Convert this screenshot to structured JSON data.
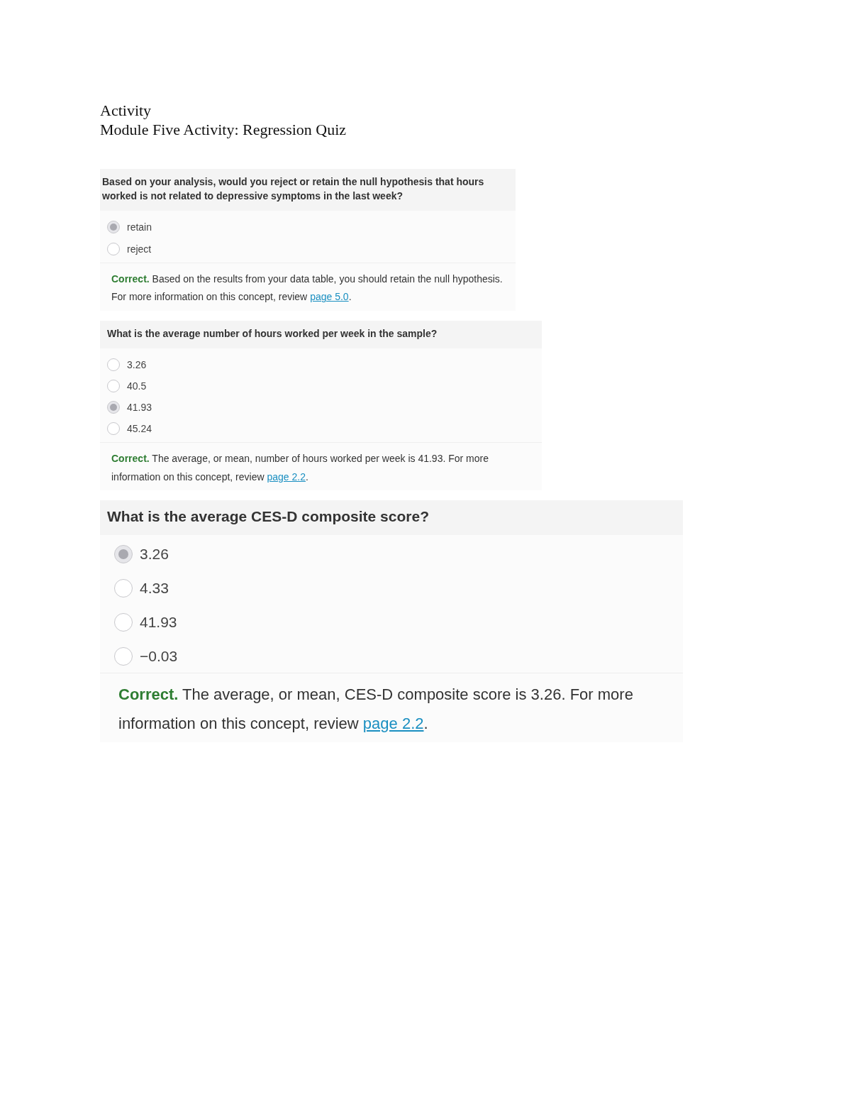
{
  "heading": {
    "lines": [
      "Activity",
      "Module Five Activity: Regression Quiz"
    ]
  },
  "questions": [
    {
      "prompt": "Based on your analysis, would you reject or retain the null hypothesis that hours worked is not related to depressive symptoms in the last week?",
      "options": [
        {
          "label": "retain",
          "selected": true
        },
        {
          "label": "reject",
          "selected": false
        }
      ],
      "feedback": {
        "verdict": "Correct.",
        "text": " Based on the results from your data table, you should retain the null hypothesis. For more information on this concept, review ",
        "link": "page 5.0",
        "after": "."
      }
    },
    {
      "prompt": "What is the average number of hours worked per week in the sample?",
      "options": [
        {
          "label": "3.26",
          "selected": false
        },
        {
          "label": "40.5",
          "selected": false
        },
        {
          "label": "41.93",
          "selected": true
        },
        {
          "label": "45.24",
          "selected": false
        }
      ],
      "feedback": {
        "verdict": "Correct.",
        "text": " The average, or mean, number of hours worked per week is 41.93. For more information on this concept, review ",
        "link": "page 2.2",
        "after": "."
      }
    },
    {
      "prompt": "What is the average CES-D composite score?",
      "options": [
        {
          "label": "3.26",
          "selected": true
        },
        {
          "label": "4.33",
          "selected": false
        },
        {
          "label": "41.93",
          "selected": false
        },
        {
          "label": "−0.03",
          "selected": false
        }
      ],
      "feedback": {
        "verdict": "Correct.",
        "text": " The average, or mean, CES-D composite score is 3.26. For more information on this concept, review ",
        "link": "page 2.2",
        "after": "."
      }
    }
  ]
}
